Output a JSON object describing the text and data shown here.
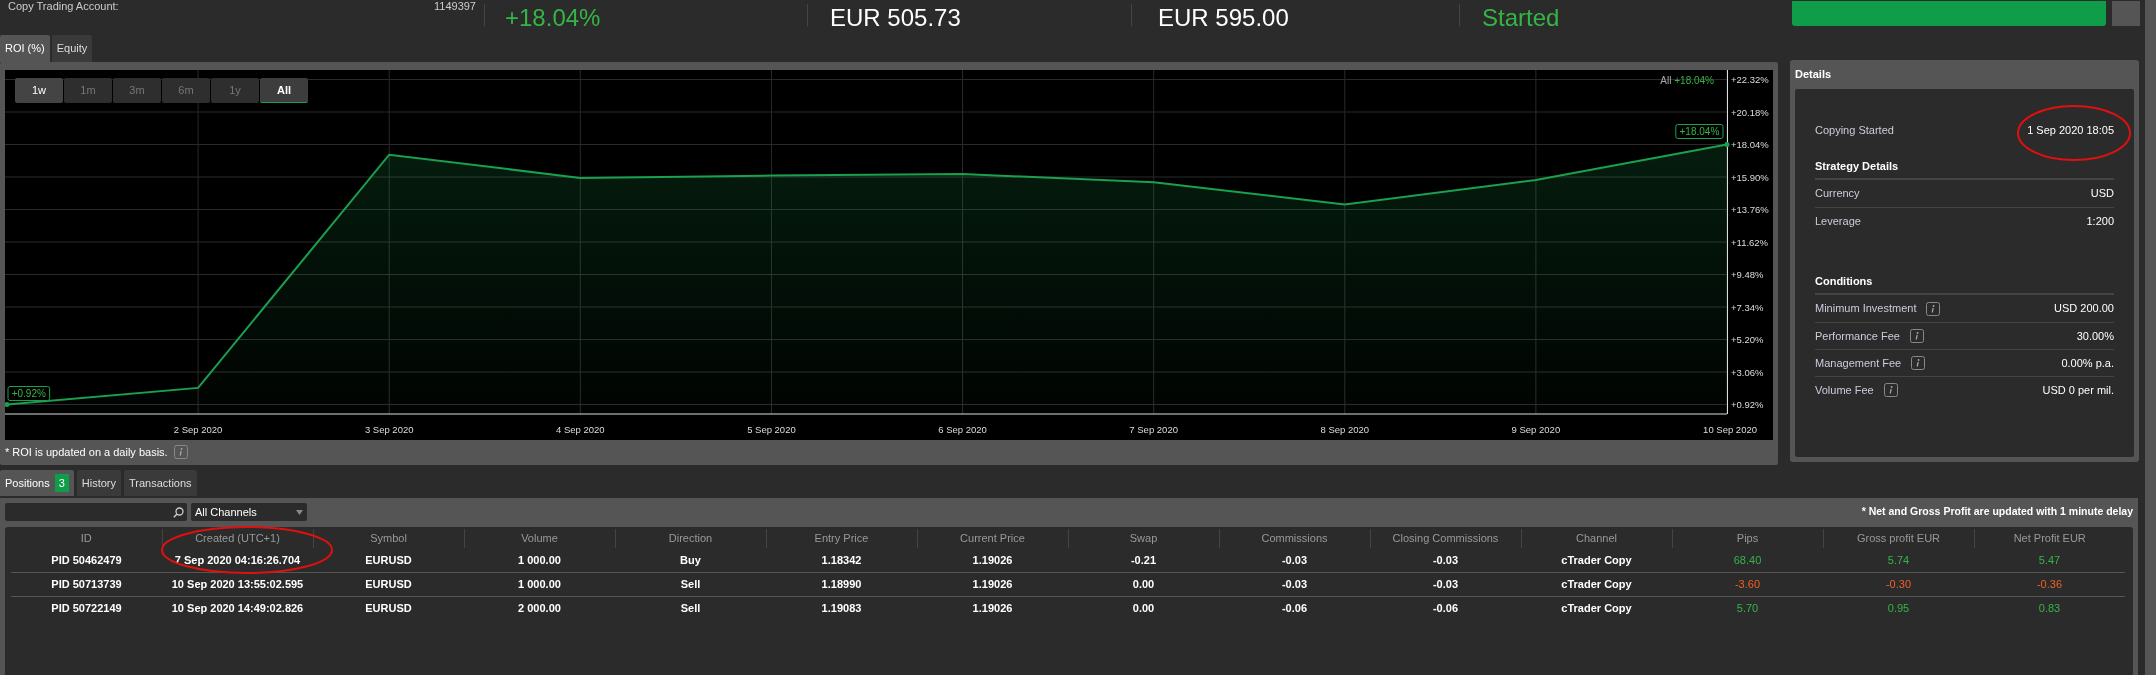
{
  "summary": {
    "account_label": "Copy Trading Account:",
    "account_value": "1149397",
    "roi": "+18.04%",
    "value_1": "EUR 505.73",
    "value_2": "EUR 595.00",
    "status": "Started"
  },
  "chart_tabs": [
    {
      "label": "ROI (%)",
      "selected": true
    },
    {
      "label": "Equity",
      "selected": false
    }
  ],
  "ranges": [
    {
      "label": "1w",
      "selected": false,
      "disabled": false
    },
    {
      "label": "1m",
      "selected": false,
      "disabled": true
    },
    {
      "label": "3m",
      "selected": false,
      "disabled": true
    },
    {
      "label": "6m",
      "selected": false,
      "disabled": true
    },
    {
      "label": "1y",
      "selected": false,
      "disabled": true
    },
    {
      "label": "All",
      "selected": true,
      "disabled": false
    }
  ],
  "legend_value": "+18.04%",
  "chart_data": {
    "type": "area",
    "categories": [
      null,
      "2 Sep 2020",
      "3 Sep 2020",
      "4 Sep 2020",
      "5 Sep 2020",
      "6 Sep 2020",
      "7 Sep 2020",
      "8 Sep 2020",
      "9 Sep 2020",
      "10 Sep 2020"
    ],
    "series": [
      {
        "name": "All",
        "color": "#1aa04f",
        "values": [
          0.92,
          2.01,
          17.37,
          15.84,
          15.99,
          16.1,
          15.55,
          14.09,
          15.7,
          18.04
        ]
      }
    ],
    "ylim": [
      0.92,
      22.32
    ],
    "yticks": [
      {
        "value": 22.32,
        "label": "+22.32%"
      },
      {
        "value": 20.18,
        "label": "+20.18%"
      },
      {
        "value": 18.04,
        "label": "+18.04%"
      },
      {
        "value": 15.9,
        "label": "+15.90%"
      },
      {
        "value": 13.76,
        "label": "+13.76%"
      },
      {
        "value": 11.62,
        "label": "+11.62%"
      },
      {
        "value": 9.48,
        "label": "+9.48%"
      },
      {
        "value": 7.34,
        "label": "+7.34%"
      },
      {
        "value": 5.2,
        "label": "+5.20%"
      },
      {
        "value": 3.06,
        "label": "+3.06%"
      },
      {
        "value": 0.92,
        "label": "+0.92%"
      }
    ],
    "grid": true,
    "annotations": [
      {
        "y": 0.92,
        "text": "+0.92%"
      },
      {
        "y": 18.04,
        "text": "+18.04%"
      }
    ]
  },
  "chart_note": "* ROI is updated on a daily basis.",
  "details": {
    "title": "Details",
    "copying_label": "Copying Started",
    "copying_value": "1 Sep 2020 18:05",
    "sections": [
      {
        "title": "Strategy Details",
        "rows": [
          {
            "label": "Currency",
            "value": "USD",
            "info": false
          },
          {
            "label": "Leverage",
            "value": "1:200",
            "info": false
          }
        ]
      },
      {
        "title": "Conditions",
        "rows": [
          {
            "label": "Minimum Investment",
            "value": "USD 200.00",
            "info": true
          },
          {
            "label": "Performance Fee",
            "value": "30.00%",
            "info": true
          },
          {
            "label": "Management Fee",
            "value": "0.00% p.a.",
            "info": true
          },
          {
            "label": "Volume Fee",
            "value": "USD 0 per mil.",
            "info": true
          }
        ]
      }
    ]
  },
  "position_tabs": [
    {
      "label": "Positions",
      "badge": "3",
      "selected": true
    },
    {
      "label": "History",
      "selected": false
    },
    {
      "label": "Transactions",
      "selected": false
    }
  ],
  "channel_filter": "All Channels",
  "profit_note": "* Net and Gross Profit are updated with 1 minute delay",
  "table": {
    "columns": [
      "ID",
      "Created (UTC+1)",
      "Symbol",
      "Volume",
      "Direction",
      "Entry Price",
      "Current Price",
      "Swap",
      "Commissions",
      "Closing Commissions",
      "Channel",
      "Pips",
      "Gross profit EUR",
      "Net Profit EUR"
    ],
    "rows": [
      {
        "loss": false,
        "cells": [
          "PID 50462479",
          "7 Sep 2020 04:16:26.704",
          "EURUSD",
          "1 000.00",
          "Buy",
          "1.18342",
          "1.19026",
          "-0.21",
          "-0.03",
          "-0.03",
          "cTrader Copy",
          "68.40",
          "5.74",
          "5.47"
        ]
      },
      {
        "loss": true,
        "cells": [
          "PID 50713739",
          "10 Sep 2020 13:55:02.595",
          "EURUSD",
          "1 000.00",
          "Sell",
          "1.18990",
          "1.19026",
          "0.00",
          "-0.03",
          "-0.03",
          "cTrader Copy",
          "-3.60",
          "-0.30",
          "-0.36"
        ]
      },
      {
        "loss": false,
        "cells": [
          "PID 50722149",
          "10 Sep 2020 14:49:02.826",
          "EURUSD",
          "2 000.00",
          "Sell",
          "1.19083",
          "1.19026",
          "0.00",
          "-0.06",
          "-0.06",
          "cTrader Copy",
          "5.70",
          "0.95",
          "0.83"
        ]
      }
    ]
  }
}
